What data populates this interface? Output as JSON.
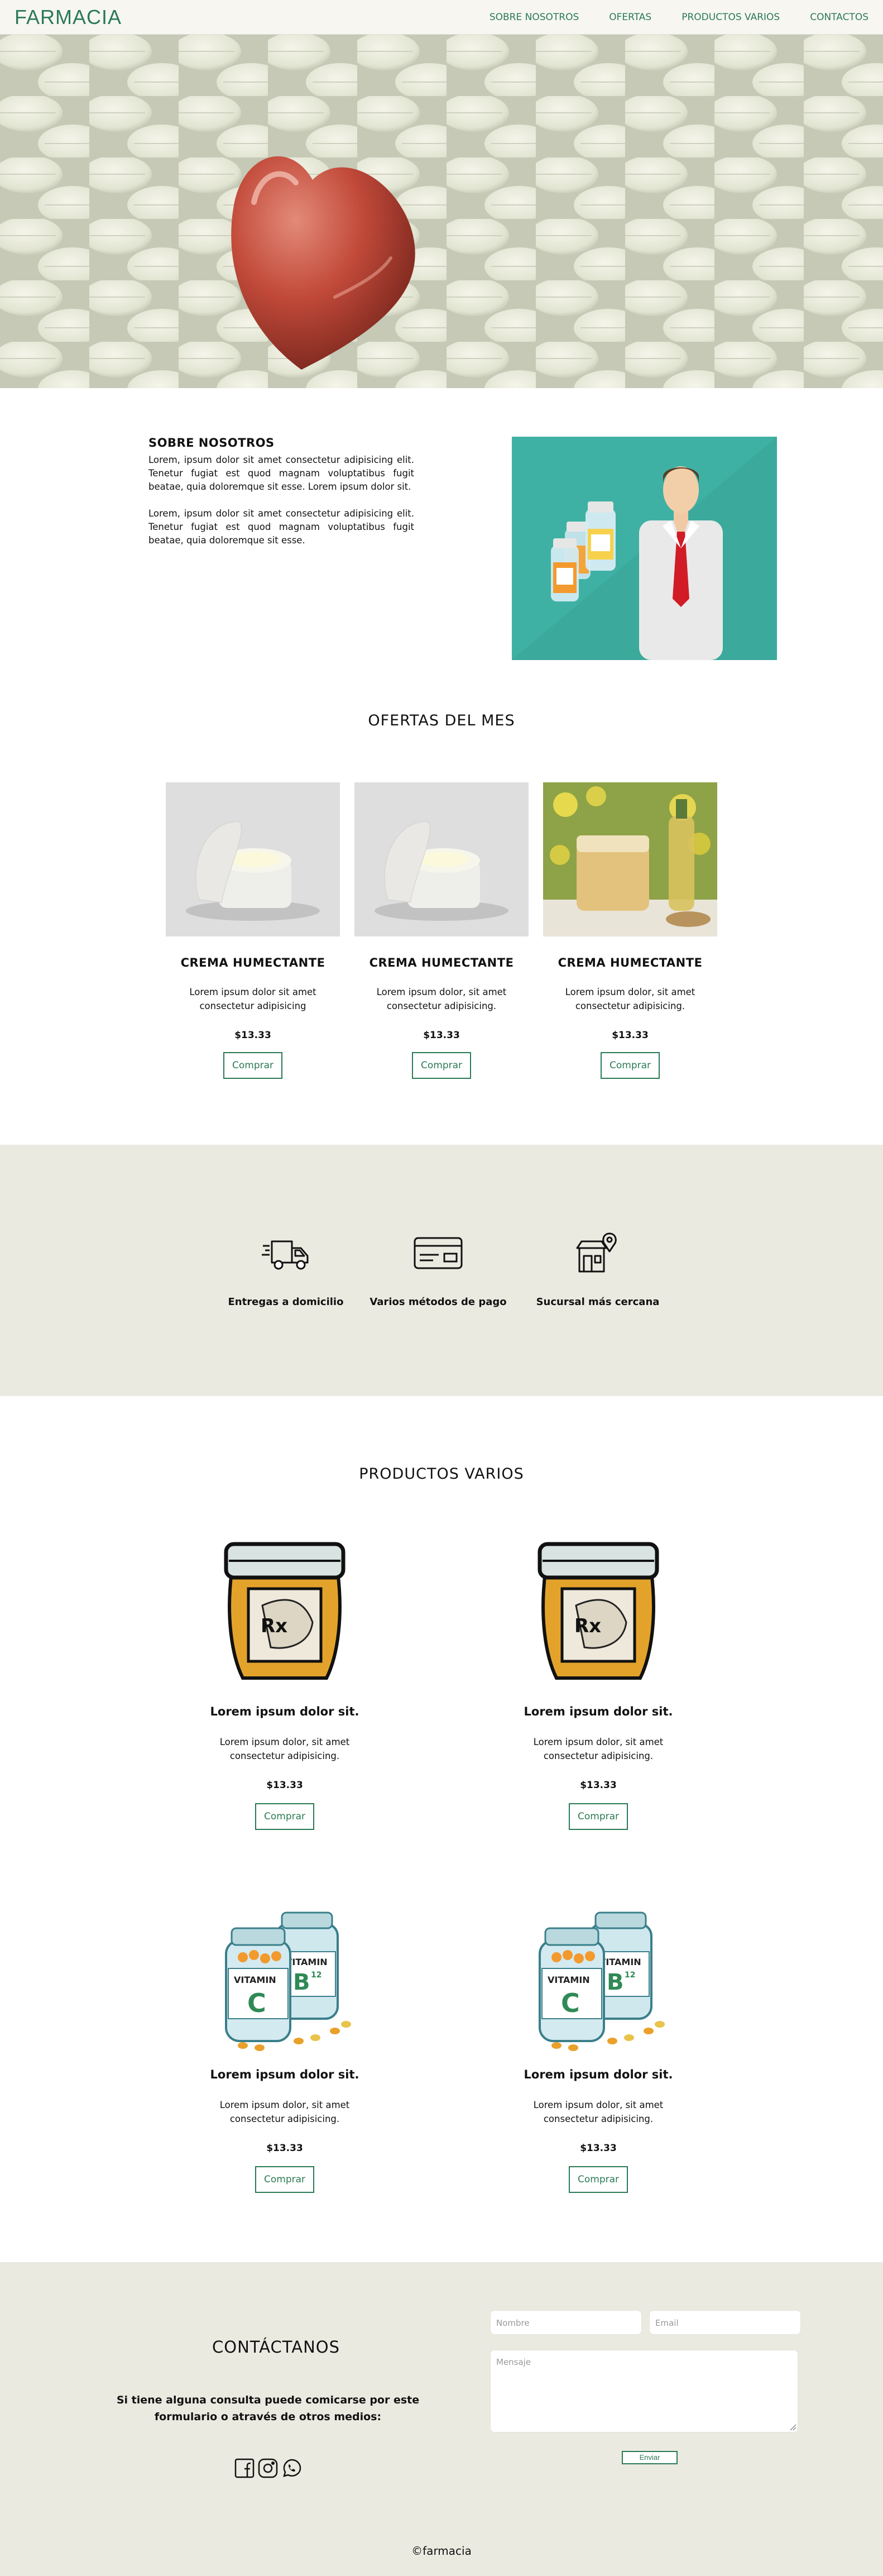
{
  "header": {
    "brand": "FARMACIA",
    "nav": [
      "SOBRE NOSOTROS",
      "OFERTAS",
      "PRODUCTOS VARIOS",
      "CONTACTOS"
    ]
  },
  "about": {
    "title": "SOBRE NOSOTROS",
    "paragraph_1": "Lorem, ipsum dolor sit amet consectetur adipisicing elit. Tenetur fugiat est quod magnam voluptatibus fugit beatae, quia doloremque sit esse. Lorem ipsum dolor sit.",
    "paragraph_2": "Lorem, ipsum dolor sit amet consectetur adipisicing elit. Tenetur fugiat est quod magnam voluptatibus fugit beatae, quia doloremque sit esse."
  },
  "offers": {
    "title": "OFERTAS DEL MES",
    "items": [
      {
        "name": "CREMA HUMECTANTE",
        "desc": "Lorem ipsum dolor sit amet consectetur adipisicing",
        "price": "$13.33",
        "button": "Comprar"
      },
      {
        "name": "CREMA HUMECTANTE",
        "desc": "Lorem ipsum dolor, sit amet consectetur adipisicing.",
        "price": "$13.33",
        "button": "Comprar"
      },
      {
        "name": "CREMA HUMECTANTE",
        "desc": "Lorem ipsum dolor, sit amet consectetur adipisicing.",
        "price": "$13.33",
        "button": "Comprar"
      }
    ]
  },
  "features": [
    {
      "label": "Entregas a domicilio",
      "icon": "delivery-truck-icon"
    },
    {
      "label": "Varios métodos de pago",
      "icon": "credit-card-icon"
    },
    {
      "label": "Sucursal más cercana",
      "icon": "store-location-icon"
    }
  ],
  "products": {
    "title": "PRODUCTOS VARIOS",
    "items": [
      {
        "name": "Lorem ipsum dolor sit.",
        "desc": "Lorem ipsum dolor, sit amet consectetur adipisicing.",
        "price": "$13.33",
        "button": "Comprar"
      },
      {
        "name": "Lorem ipsum dolor sit.",
        "desc": "Lorem ipsum dolor, sit amet consectetur adipisicing.",
        "price": "$13.33",
        "button": "Comprar"
      },
      {
        "name": "Lorem ipsum dolor sit.",
        "desc": "Lorem ipsum dolor, sit amet consectetur adipisicing.",
        "price": "$13.33",
        "button": "Comprar"
      },
      {
        "name": "Lorem ipsum dolor sit.",
        "desc": "Lorem ipsum dolor, sit amet consectetur adipisicing.",
        "price": "$13.33",
        "button": "Comprar"
      }
    ],
    "vitamin_label_1": "VITAMIN",
    "vitamin_letter_c": "C",
    "vitamin_letter_b": "B",
    "vitamin_sub": "12",
    "rx_label": "Rx"
  },
  "contact": {
    "title": "CONTÁCTANOS",
    "text": "Si tiene alguna consulta puede comicarse por este formulario o através de otros medios:",
    "name_placeholder": "Nombre",
    "email_placeholder": "Email",
    "message_placeholder": "Mensaje",
    "send": "Enviar",
    "socials": [
      "facebook-icon",
      "instagram-icon",
      "whatsapp-icon"
    ]
  },
  "footer": "©farmacia",
  "colors": {
    "accent": "#2a7a54",
    "band": "#ebeae1",
    "header_bg": "#f7f6f1"
  }
}
